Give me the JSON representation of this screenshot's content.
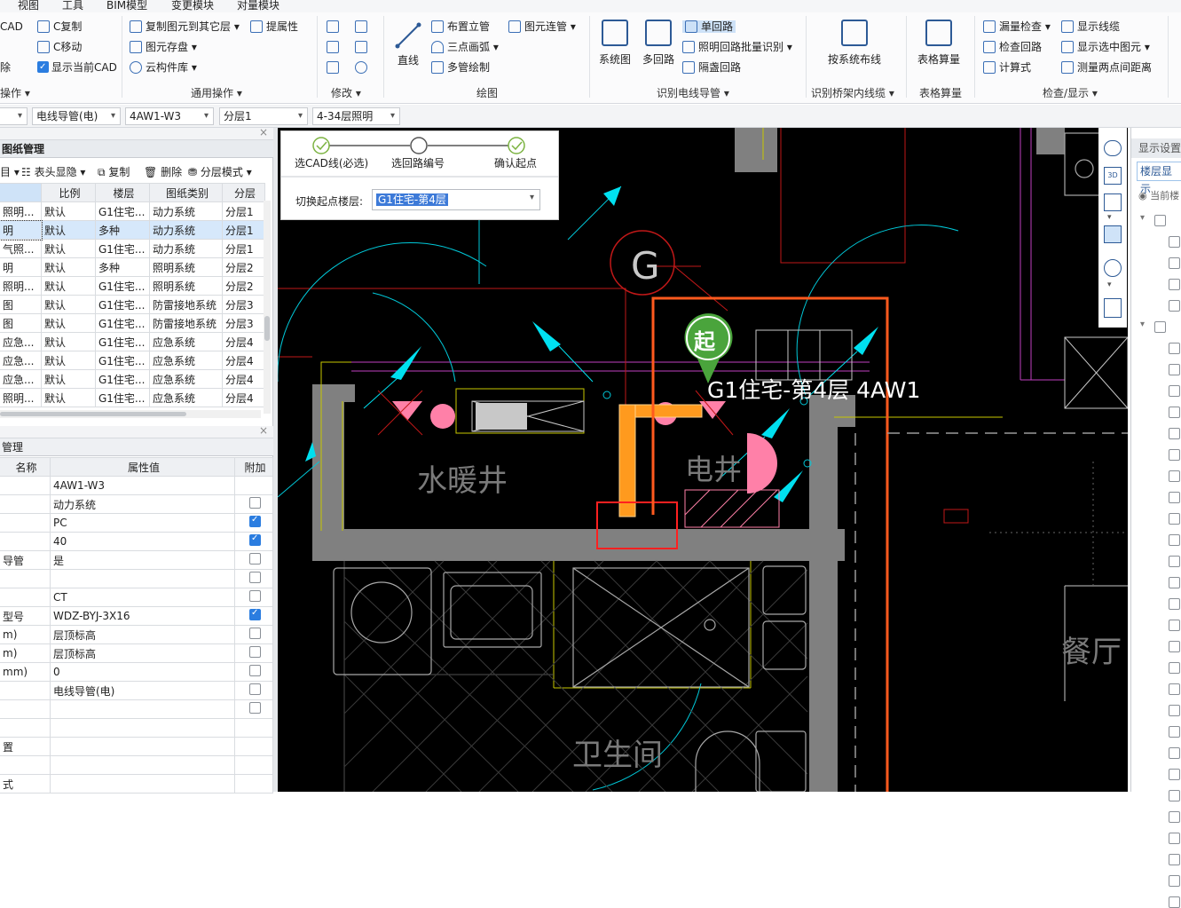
{
  "menubar": {
    "items": [
      "视图",
      "工具",
      "BIM模型",
      "变更模块",
      "对量模块"
    ]
  },
  "ribbon": {
    "cad_col": [
      "CAD",
      "C复制",
      "C移动",
      "显示当前CAD"
    ],
    "general": [
      "复制图元到其它层",
      "提属性",
      "图元存盘",
      "云构件库"
    ],
    "draw": [
      "直线",
      "布置立管",
      "三点画弧",
      "多管绘制",
      "图元连管"
    ],
    "identify": [
      "系统图",
      "多回路",
      "单回路",
      "照明回路批量识别",
      "隔盏回路"
    ],
    "tray": [
      "按系统布线"
    ],
    "table": [
      "表格算量"
    ],
    "check": [
      "漏量检查",
      "检查回路",
      "计算式",
      "显示线缆",
      "显示选中图元",
      "测量两点间距离"
    ],
    "group_labels": {
      "g0": "操作",
      "general": "通用操作",
      "modify": "修改",
      "draw": "绘图",
      "identify": "识别电线导管",
      "tray": "识别桥架内线缆",
      "table": "表格算量",
      "check": "检查/显示"
    }
  },
  "combos": [
    "电线导管(电)",
    "4AW1-W3",
    "分层1",
    "4-34层照明"
  ],
  "drawing_panel": {
    "title": "图纸管理",
    "tools": [
      "表头显隐",
      "复制",
      "删除",
      "分层模式"
    ],
    "headers": [
      "比例",
      "楼层",
      "图纸类别",
      "分层"
    ],
    "rows": [
      [
        "照明...",
        "默认",
        "G1住宅...",
        "动力系统",
        "分层1"
      ],
      [
        "明",
        "默认",
        "多种",
        "动力系统",
        "分层1"
      ],
      [
        "气照...",
        "默认",
        "G1住宅...",
        "动力系统",
        "分层1"
      ],
      [
        "明",
        "默认",
        "多种",
        "照明系统",
        "分层2"
      ],
      [
        "照明...",
        "默认",
        "G1住宅...",
        "照明系统",
        "分层2"
      ],
      [
        "图",
        "默认",
        "G1住宅...",
        "防雷接地系统",
        "分层3"
      ],
      [
        "图",
        "默认",
        "G1住宅...",
        "防雷接地系统",
        "分层3"
      ],
      [
        "应急...",
        "默认",
        "G1住宅...",
        "应急系统",
        "分层4"
      ],
      [
        "应急...",
        "默认",
        "G1住宅...",
        "应急系统",
        "分层4"
      ],
      [
        "应急...",
        "默认",
        "G1住宅...",
        "应急系统",
        "分层4"
      ],
      [
        "照明...",
        "默认",
        "G1住宅...",
        "应急系统",
        "分层4"
      ]
    ]
  },
  "prop_panel": {
    "title": "管理",
    "headers": [
      "名称",
      "属性值",
      "附加"
    ],
    "rows": [
      [
        "",
        "4AW1-W3",
        null
      ],
      [
        "",
        "动力系统",
        false
      ],
      [
        "",
        "PC",
        true
      ],
      [
        "",
        "40",
        true
      ],
      [
        "导管",
        "是",
        false
      ],
      [
        "",
        "",
        false
      ],
      [
        "",
        "CT",
        false
      ],
      [
        "型号",
        "WDZ-BYJ-3X16",
        true
      ],
      [
        "m)",
        "层顶标高",
        false
      ],
      [
        "m)",
        "层顶标高",
        false
      ],
      [
        "mm)",
        "0",
        false
      ],
      [
        "",
        "电线导管(电)",
        false
      ],
      [
        "",
        "",
        false
      ],
      [
        "",
        "",
        null
      ],
      [
        "置",
        "",
        null
      ],
      [
        "",
        "",
        null
      ],
      [
        "式",
        "",
        null
      ]
    ]
  },
  "wizard": {
    "steps": [
      "选CAD线(必选)",
      "选回路编号",
      "确认起点"
    ],
    "floor_label": "切换起点楼层:",
    "floor_value": "G1住宅-第4层"
  },
  "canvas": {
    "marker": "起",
    "marker_label": "G1住宅-第4层 4AW1",
    "room1": "水暖井",
    "room2": "电井",
    "room3": "卫生间",
    "room4": "餐厅",
    "g_symbol": "G"
  },
  "right_panel": {
    "title": "显示设置",
    "tab": "楼层显示",
    "radio": "当前楼"
  }
}
